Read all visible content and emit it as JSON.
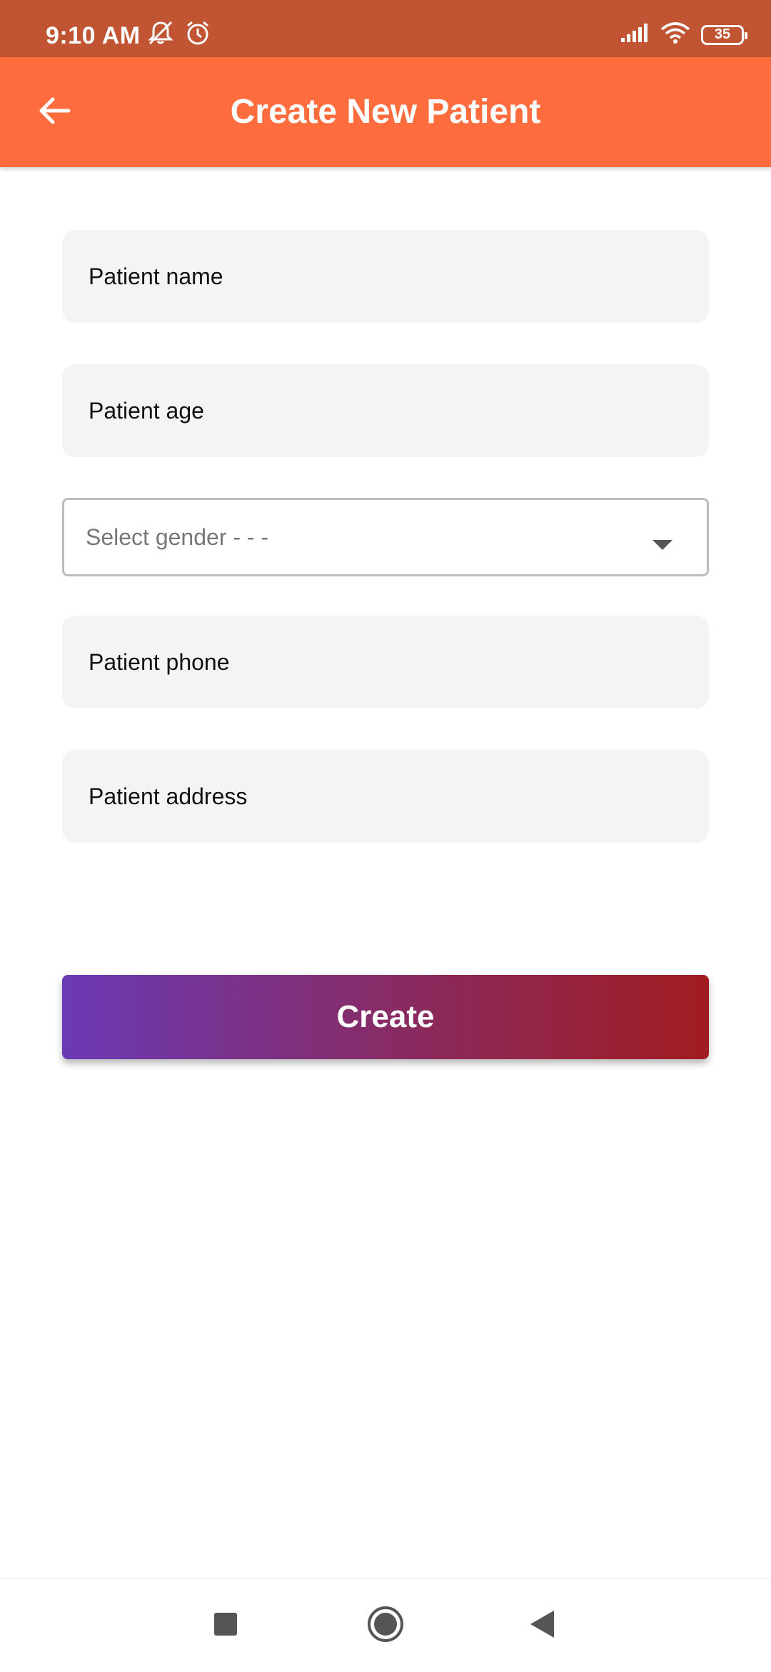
{
  "status_bar": {
    "time": "9:10 AM",
    "battery": "35",
    "icons": [
      "mute-icon",
      "alarm-icon",
      "signal-icon",
      "wifi-icon",
      "battery-icon"
    ]
  },
  "app_bar": {
    "title": "Create New Patient",
    "back_icon": "arrow-left-icon",
    "color": "#FF6D3F"
  },
  "form": {
    "patient_name_placeholder": "Patient name",
    "patient_age_placeholder": "Patient age",
    "gender_placeholder": "Select gender - - -",
    "patient_phone_placeholder": "Patient phone",
    "patient_address_placeholder": "Patient address"
  },
  "actions": {
    "create_label": "Create",
    "gradient_start": "#6A3AB6",
    "gradient_end": "#A01C20"
  },
  "nav_bar": {
    "icons": [
      "recents-icon",
      "home-icon",
      "back-icon"
    ]
  }
}
